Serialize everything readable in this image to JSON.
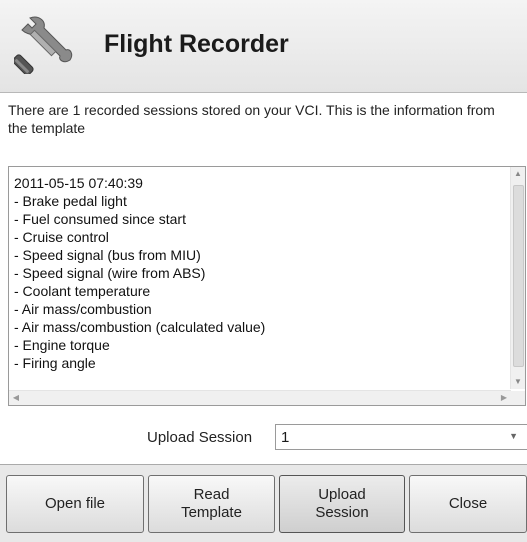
{
  "header": {
    "title": "Flight Recorder",
    "icon": "tools-icon"
  },
  "info_text": "There are 1 recorded sessions stored on your VCI. This is the information from the template",
  "session_list": {
    "lines": [
      "2011-05-15 07:40:39",
      "- Brake pedal light",
      "- Fuel consumed since start",
      "- Cruise control",
      "- Speed signal (bus from MIU)",
      "- Speed signal (wire from ABS)",
      "- Coolant temperature",
      "- Air mass/combustion",
      "- Air mass/combustion (calculated value)",
      "- Engine torque",
      "- Firing angle"
    ]
  },
  "upload_session": {
    "label": "Upload Session",
    "value": "1"
  },
  "buttons": {
    "open_file": "Open file",
    "read_template": "Read\nTemplate",
    "upload_session": "Upload\nSession",
    "close": "Close"
  }
}
